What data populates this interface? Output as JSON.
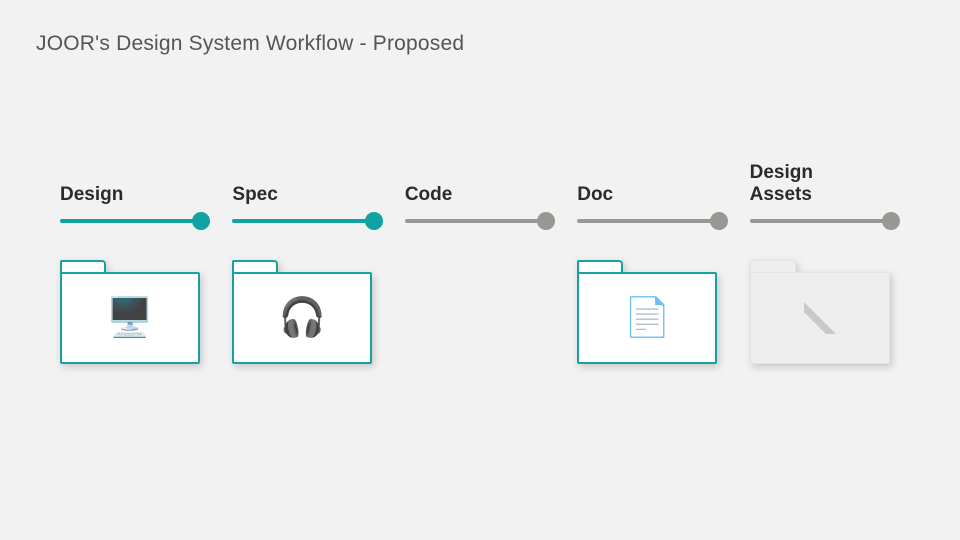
{
  "title": "JOOR's Design System Workflow - Proposed",
  "colors": {
    "active": "#0fa3a3",
    "inactive": "#999793"
  },
  "stages": [
    {
      "label": "Design",
      "state": "active",
      "folder": true,
      "icon": "monitor"
    },
    {
      "label": "Spec",
      "state": "active",
      "folder": true,
      "icon": "headphones"
    },
    {
      "label": "Code",
      "state": "inactive",
      "folder": false,
      "icon": null
    },
    {
      "label": "Doc",
      "state": "inactive",
      "folder": true,
      "icon": "document"
    },
    {
      "label": "Design\nAssets",
      "state": "inactive",
      "folder": true,
      "icon": "triangle-ruler"
    }
  ],
  "icon_glyphs": {
    "monitor": "🖥️",
    "headphones": "🎧",
    "document": "📄",
    "triangle-ruler": ""
  }
}
